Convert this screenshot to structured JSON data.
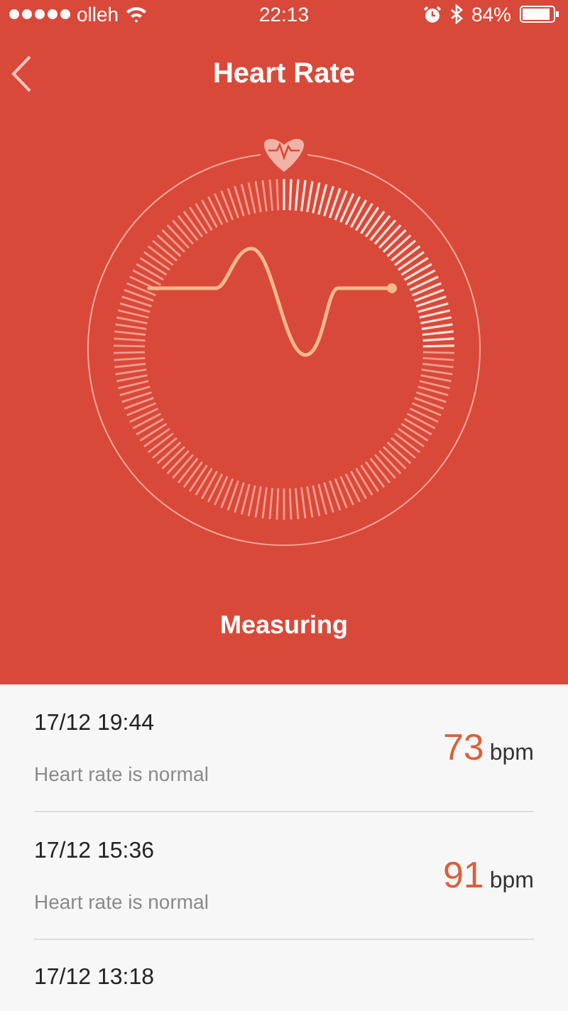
{
  "status_bar": {
    "carrier": "olleh",
    "time": "22:13",
    "battery": "84%"
  },
  "nav": {
    "title": "Heart Rate"
  },
  "status_text": "Measuring",
  "records": [
    {
      "time": "17/12 19:44",
      "note": "Heart rate is normal",
      "value": "73",
      "unit": "bpm"
    },
    {
      "time": "17/12 15:36",
      "note": "Heart rate is normal",
      "value": "91",
      "unit": "bpm"
    },
    {
      "time": "17/12 13:18"
    }
  ]
}
